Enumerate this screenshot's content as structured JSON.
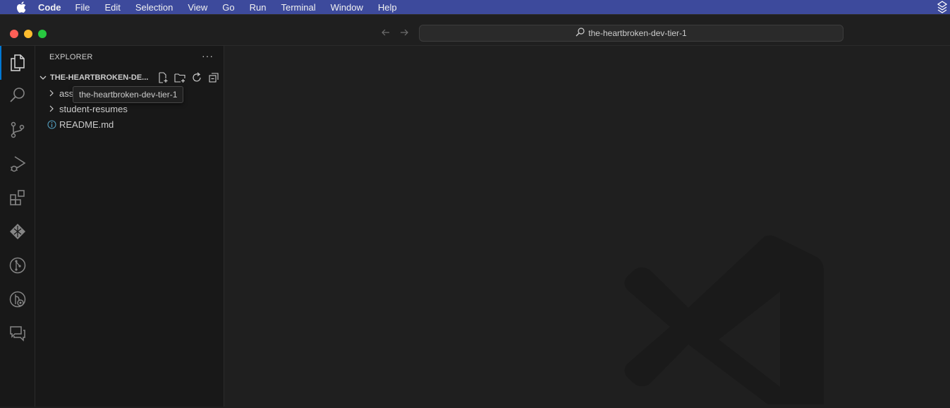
{
  "menubar": {
    "apple_icon": "apple-icon",
    "app_name": "Code",
    "items": [
      "File",
      "Edit",
      "Selection",
      "View",
      "Go",
      "Run",
      "Terminal",
      "Window",
      "Help"
    ],
    "right_icon": "layers-icon"
  },
  "titlebar": {
    "command_center_text": "the-heartbroken-dev-tier-1",
    "back_icon": "arrow-left-icon",
    "forward_icon": "arrow-right-icon"
  },
  "activitybar": {
    "items": [
      "explorer-icon",
      "search-icon",
      "source-control-icon",
      "run-debug-icon",
      "extensions-icon",
      "remote-explorer-icon",
      "git-graph-icon",
      "gitlens-icon",
      "chat-icon"
    ],
    "accent": "#0078d4"
  },
  "sidebar": {
    "title": "EXPLORER",
    "more": "···",
    "folder_name": "THE-HEARTBROKEN-DE...",
    "tree": [
      {
        "label": "ass",
        "kind": "folder"
      },
      {
        "label": "student-resumes",
        "kind": "folder"
      },
      {
        "label": "README.md",
        "kind": "file-info"
      }
    ],
    "tooltip": "the-heartbroken-dev-tier-1"
  },
  "colors": {
    "menubar": "#3d4a9c",
    "editor_bg": "#1f1f1f",
    "sidebar_bg": "#181818"
  }
}
